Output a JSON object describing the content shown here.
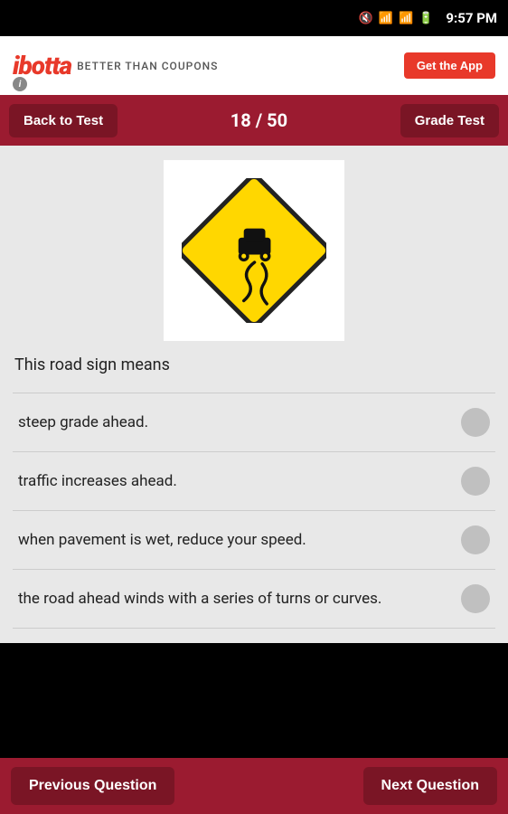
{
  "statusBar": {
    "time": "9:57 PM"
  },
  "ad": {
    "logo": "ibotta",
    "tagline": "BETTER THAN COUPONS",
    "buttonLabel": "Get the App",
    "infoIcon": "i"
  },
  "topNav": {
    "backLabel": "Back to Test",
    "counter": "18 / 50",
    "gradeLabel": "Grade Test"
  },
  "question": {
    "text": "This road sign means"
  },
  "answers": [
    {
      "id": 1,
      "text": "steep grade ahead."
    },
    {
      "id": 2,
      "text": "traffic increases ahead."
    },
    {
      "id": 3,
      "text": "when pavement is wet, reduce your speed."
    },
    {
      "id": 4,
      "text": "the road ahead winds with a series of turns or curves."
    }
  ],
  "bottomNav": {
    "previousLabel": "Previous Question",
    "nextLabel": "Next Question"
  }
}
